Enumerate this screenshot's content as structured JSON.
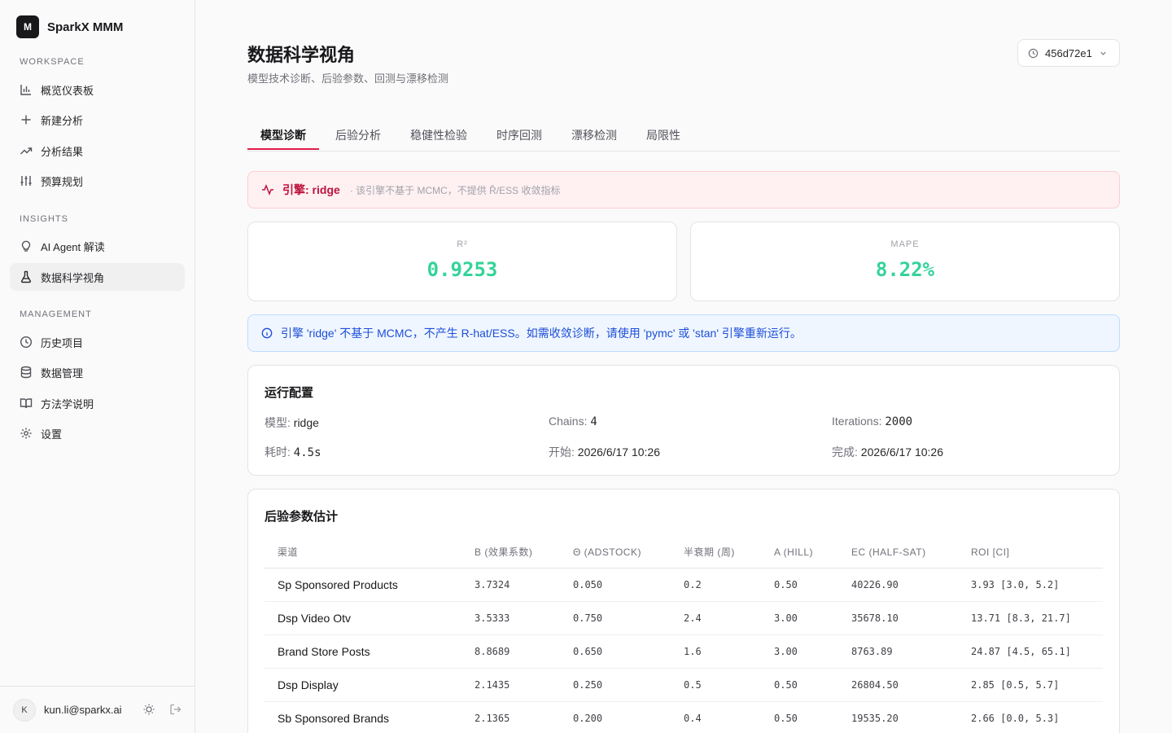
{
  "brand": {
    "logo": "M",
    "name": "SparkX MMM"
  },
  "sidebar": {
    "sections": [
      {
        "label": "WORKSPACE",
        "items": [
          {
            "label": "概览仪表板",
            "icon": "bar-chart-icon"
          },
          {
            "label": "新建分析",
            "icon": "plus-icon"
          },
          {
            "label": "分析结果",
            "icon": "trending-up-icon"
          },
          {
            "label": "预算规划",
            "icon": "sliders-icon"
          }
        ]
      },
      {
        "label": "INSIGHTS",
        "items": [
          {
            "label": "AI Agent 解读",
            "icon": "lightbulb-icon"
          },
          {
            "label": "数据科学视角",
            "icon": "flask-icon",
            "active": true
          }
        ]
      },
      {
        "label": "MANAGEMENT",
        "items": [
          {
            "label": "历史项目",
            "icon": "clock-icon"
          },
          {
            "label": "数据管理",
            "icon": "database-icon"
          },
          {
            "label": "方法学说明",
            "icon": "book-icon"
          },
          {
            "label": "设置",
            "icon": "gear-icon"
          }
        ]
      }
    ]
  },
  "user": {
    "initial": "K",
    "email": "kun.li@sparkx.ai"
  },
  "page": {
    "title": "数据科学视角",
    "subtitle": "模型技术诊断、后验参数、回测与漂移检测",
    "run_id": "456d72e1"
  },
  "tabs": [
    "模型诊断",
    "后验分析",
    "稳健性检验",
    "时序回测",
    "漂移检测",
    "局限性"
  ],
  "engine_banner": {
    "label": "引擎: ridge",
    "note": "· 该引擎不基于 MCMC，不提供 R̂/ESS 收敛指标"
  },
  "metrics": [
    {
      "label": "R²",
      "value": "0.9253"
    },
    {
      "label": "MAPE",
      "value": "8.22%"
    }
  ],
  "info_banner": "引擎 'ridge' 不基于 MCMC，不产生 R-hat/ESS。如需收敛诊断，请使用 'pymc' 或 'stan' 引擎重新运行。",
  "run_config": {
    "title": "运行配置",
    "items": [
      {
        "key": "模型:",
        "value": "ridge"
      },
      {
        "key": "Chains:",
        "value": "4"
      },
      {
        "key": "Iterations:",
        "value": "2000"
      },
      {
        "key": "耗时:",
        "value": "4.5s"
      },
      {
        "key": "开始:",
        "value": "2026/6/17 10:26"
      },
      {
        "key": "完成:",
        "value": "2026/6/17 10:26"
      }
    ]
  },
  "posterior": {
    "title": "后验参数估计",
    "columns": [
      "渠道",
      "Β (效果系数)",
      "Θ (ADSTOCK)",
      "半衰期 (周)",
      "Α (HILL)",
      "EC (HALF-SAT)",
      "ROI [CI]"
    ],
    "rows": [
      [
        "Sp Sponsored Products",
        "3.7324",
        "0.050",
        "0.2",
        "0.50",
        "40226.90",
        "3.93 [3.0, 5.2]"
      ],
      [
        "Dsp Video Otv",
        "3.5333",
        "0.750",
        "2.4",
        "3.00",
        "35678.10",
        "13.71 [8.3, 21.7]"
      ],
      [
        "Brand Store Posts",
        "8.8689",
        "0.650",
        "1.6",
        "3.00",
        "8763.89",
        "24.87 [4.5, 65.1]"
      ],
      [
        "Dsp Display",
        "2.1435",
        "0.250",
        "0.5",
        "0.50",
        "26804.50",
        "2.85 [0.5, 5.7]"
      ],
      [
        "Sb Sponsored Brands",
        "2.1365",
        "0.200",
        "0.4",
        "0.50",
        "19535.20",
        "2.66 [0.0, 5.3]"
      ]
    ]
  }
}
